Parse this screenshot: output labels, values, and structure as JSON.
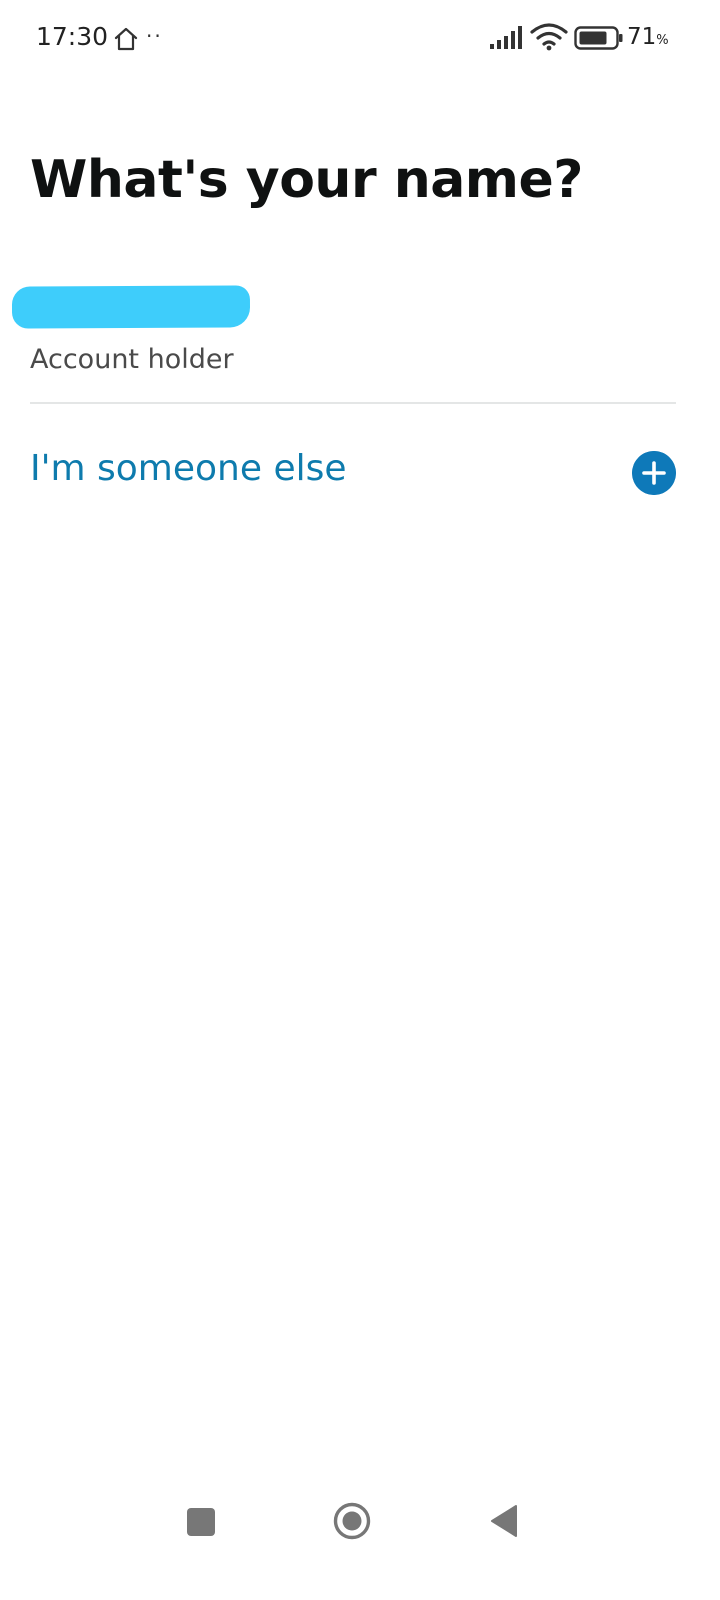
{
  "status_bar": {
    "time": "17:30",
    "dots": "··",
    "battery_level": "71",
    "battery_unit": "%"
  },
  "main": {
    "title": "What's your name?",
    "profiles": [
      {
        "name": "",
        "role": "Account holder"
      }
    ],
    "someone_else_label": "I'm someone else"
  },
  "icons": {
    "home": "home-outline-icon",
    "signal": "cellular-signal-icon",
    "wifi": "wifi-icon",
    "battery": "battery-icon",
    "add": "plus-circle-icon",
    "nav_recent": "square-icon",
    "nav_home": "circle-icon",
    "nav_back": "triangle-back-icon"
  },
  "colors": {
    "link": "#0e7bad",
    "add_button": "#0e79b9",
    "redaction": "#3ecdfb",
    "title": "#0f1111",
    "divider": "#e4e6e6"
  }
}
